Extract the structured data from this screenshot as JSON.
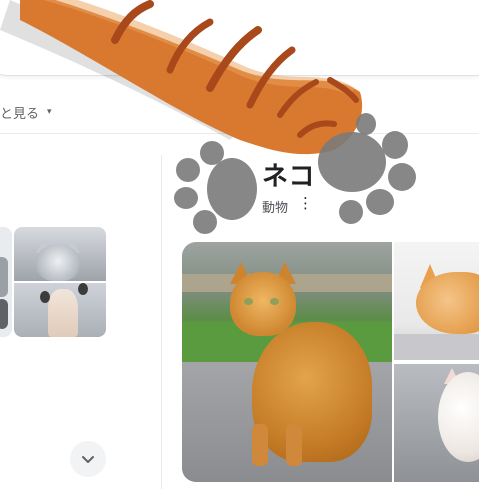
{
  "search": {
    "value": "",
    "placeholder": ""
  },
  "tools": {
    "label": "と見る",
    "caret": "▾"
  },
  "knowledge_panel": {
    "title": "ネコ",
    "subtitle": "動物",
    "more_icon": "more-vert-icon"
  },
  "images": {
    "main": "orange-tabby-cat-sitting",
    "side_top": "orange-cat-face-closeup",
    "side_bottom": "white-fluffy-cat",
    "left_top": "gray-cat-face",
    "left_bottom": "cat-with-paw-raised"
  },
  "overlay": {
    "paw_arm_color": "#D9782F",
    "stripe_color": "#A9481A",
    "paw_pad_color": "#7A7A7A"
  },
  "expand_icon": "chevron-down-icon"
}
